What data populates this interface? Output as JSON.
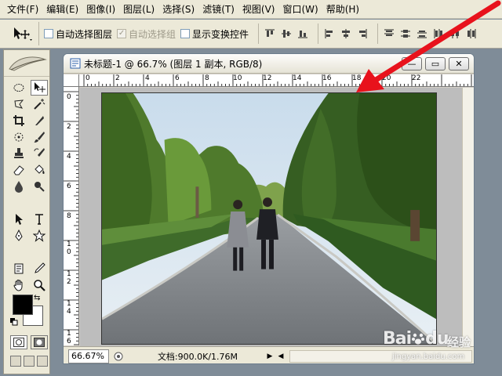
{
  "menubar": {
    "items": [
      "文件(F)",
      "编辑(E)",
      "图像(I)",
      "图层(L)",
      "选择(S)",
      "滤镜(T)",
      "视图(V)",
      "窗口(W)",
      "帮助(H)"
    ]
  },
  "options": {
    "auto_select_layer": {
      "label": "自动选择图层",
      "checked": false
    },
    "auto_select_group": {
      "label": "自动选择组",
      "checked": true,
      "enabled": false
    },
    "show_transform": {
      "label": "显示变换控件",
      "checked": false
    }
  },
  "document": {
    "title": "未标题-1 @ 66.7% (图层 1 副本, RGB/8)",
    "zoom": "66.67%",
    "doc_info": "文档:900.0K/1.76M"
  },
  "rulers": {
    "h_labels": [
      "0",
      "2",
      "4",
      "6",
      "8",
      "10",
      "12",
      "14",
      "16",
      "18",
      "20",
      "22"
    ],
    "v_labels": [
      "0",
      "2",
      "4",
      "6",
      "8",
      "1\n0",
      "1\n2",
      "1\n4",
      "1\n6"
    ]
  },
  "colors": {
    "foreground": "#000000",
    "background": "#ffffff",
    "annotation_arrow": "#e8121c"
  },
  "watermark": {
    "brand": "Bai",
    "brand_suffix": "du",
    "sub": "经验",
    "url": "jingyan.baidu.com"
  }
}
